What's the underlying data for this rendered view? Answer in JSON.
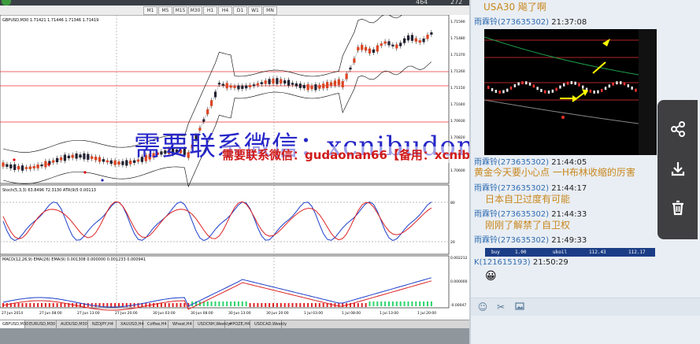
{
  "top": {
    "stat1": "464",
    "stat2": "272"
  },
  "toolbar": {
    "buttons": [
      "M1",
      "M5",
      "M15",
      "M30",
      "H1",
      "H4",
      "D1",
      "W1",
      "MN"
    ]
  },
  "chart": {
    "symbol_header": "GBPUSD,M30  1.71421 1.71446 1.71346 1.71419",
    "stoch_header": "Stoch(5,3,3) 63.8496 72.3130  ATR(9)5 0.00113",
    "macd_header": "MACD(12,26,9) EMA(26) EMA(9) 0.001308 0.000000 0.001233 0.000941",
    "price_labels": [
      "1.71590",
      "1.71480",
      "1.71370",
      "1.71260",
      "1.71150",
      "1.71040",
      "1.70930",
      "1.70820",
      "1.70710",
      "1.70600"
    ],
    "time_labels": [
      "27 Jun 2014",
      "27 Jun 08:00",
      "27 Jun 13:00",
      "27 Jun 20:00",
      "30 Jun 03:00",
      "30 Jun 08:00",
      "30 Jun 13:00",
      "30 Jun 20:00",
      "1 Jul 03:00",
      "1 Jul 08:00",
      "1 Jul 13:00",
      "1 Jul 20:00"
    ],
    "stoch_levels": [
      "80",
      "20"
    ],
    "macd_levels": [
      "0.002212",
      "0.000000",
      "-0.00047"
    ]
  },
  "tabs": [
    "GBPUSD,M30",
    "EURUSD,M30",
    "AUDUSD,M30",
    "NZDJPY,H4",
    "XAUUSD,H4",
    "Coffee,H4",
    "Wheat,H4",
    "USDCNH,Weekly",
    "#POZE,H4",
    "USDCAD,Weekly"
  ],
  "watermark": {
    "line1": "需要联系微信：xcnibudong0105",
    "line2": "需要联系微信：gudaonan66【备用：xcnibudong0105】"
  },
  "chat": {
    "title_msg": "USA30  飚了啊",
    "messages": [
      {
        "sender": "雨霖铃",
        "qq": "273635302",
        "time": "21:37:08",
        "text": ""
      },
      {
        "sender": "",
        "qq": "",
        "time": "",
        "text": "黄金今天要小心点  一H布林收缩的厉害"
      },
      {
        "sender": "雨霖铃",
        "qq": "273635302",
        "time": "21:44:05",
        "text": ""
      },
      {
        "sender": "雨霖铃",
        "qq": "273635302",
        "time": "21:44:17",
        "text": "日本自卫过度有可能"
      },
      {
        "sender": "雨霖铃",
        "qq": "273635302",
        "time": "21:44:33",
        "text": "刚刚了解禁了自卫权"
      },
      {
        "sender": "雨霖铃",
        "qq": "273635302",
        "time": "21:49:33",
        "text": ""
      },
      {
        "sender": "K",
        "qq": "121615193",
        "time": "21:50:29",
        "text": ""
      }
    ],
    "quote_bar": {
      "label": "buy",
      "qty": "1.00",
      "symbol": "ukoil",
      "price1": "112.43",
      "price2": "112.17"
    },
    "emoji": "😀"
  },
  "chat_toolbar": {
    "icons": [
      "smile-icon",
      "scissors-icon",
      "image-icon"
    ]
  },
  "sidebar": {
    "icons": [
      "share-icon",
      "download-icon",
      "trash-icon"
    ]
  }
}
